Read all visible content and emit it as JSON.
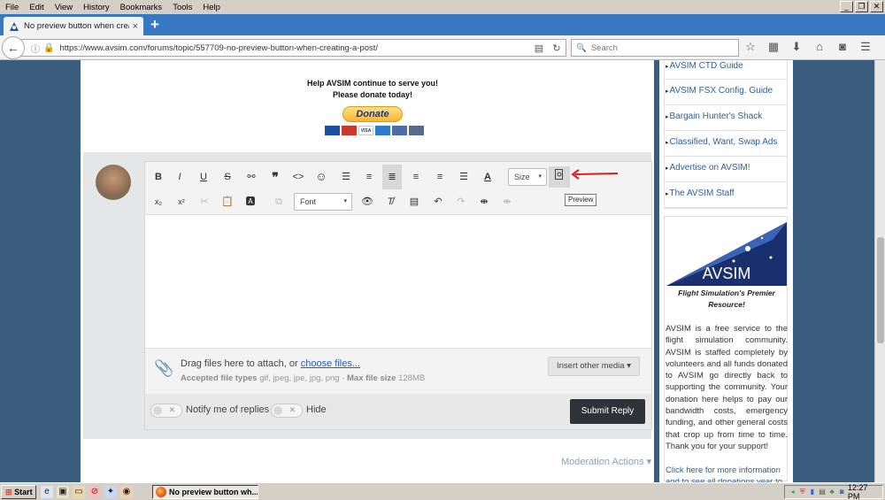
{
  "menu": {
    "items": [
      "File",
      "Edit",
      "View",
      "History",
      "Bookmarks",
      "Tools",
      "Help"
    ]
  },
  "window_controls": {
    "minimize": "_",
    "restore": "❐",
    "close": "✕"
  },
  "tab": {
    "title": "No preview button when crea...",
    "close": "×",
    "new": "+"
  },
  "nav": {
    "url": "https://www.avsim.com/forums/topic/557709-no-preview-button-when-creating-a-post/",
    "search_placeholder": "Search"
  },
  "donate": {
    "line1": "Help AVSIM continue to serve you!",
    "line2": "Please donate today!",
    "button": "Donate",
    "cards": [
      "Maestro",
      "MasterCard",
      "VISA",
      "AMEX",
      "PayPal",
      "BANK"
    ]
  },
  "editor": {
    "toolbar_row1": [
      "B",
      "I",
      "U",
      "S",
      "🔗",
      "❞",
      "<>",
      "☺",
      "list-bulleted",
      "list-numbered",
      "align-left",
      "align-center",
      "align-right",
      "justify",
      "text-color"
    ],
    "size_select": "Size",
    "font_select": "Font",
    "preview_tooltip": "Preview",
    "attach": {
      "drag_text": "Drag files here to attach, or ",
      "choose_link": "choose files...",
      "types_label": "Accepted file types",
      "types_value": " gif, jpeg, jpe, jpg, png · ",
      "max_label": "Max file size",
      "max_value": " 128MB",
      "insert_media": "Insert other media ▾"
    },
    "notify_label": "Notify me of replies",
    "hide_label": "Hide",
    "submit_label": "Submit Reply"
  },
  "moderation_actions": "Moderation Actions ▾",
  "sidebar": {
    "links": [
      "AVSIM CTD Guide",
      "AVSIM FSX Config. Guide",
      "Bargain Hunter's Shack",
      "Classified, Want, Swap Ads",
      "Advertise on AVSIM!",
      "The AVSIM Staff"
    ],
    "logo_text": "AVSIM",
    "tagline": "Flight Simulation's Premier Resource!",
    "blurb": "AVSIM is a free service to the flight simulation community. AVSIM is staffed completely by volunteers and all funds donated to AVSIM go directly back to supporting the community. Your donation here helps to pay our bandwidth costs, emergency funding, and other general costs that crop up from time to time. Thank you for your support!",
    "click_here": "Click here for more information and to see all donations year to"
  },
  "taskbar": {
    "start": "Start",
    "task_title": "No preview button wh...",
    "clock": "12:27 PM"
  }
}
